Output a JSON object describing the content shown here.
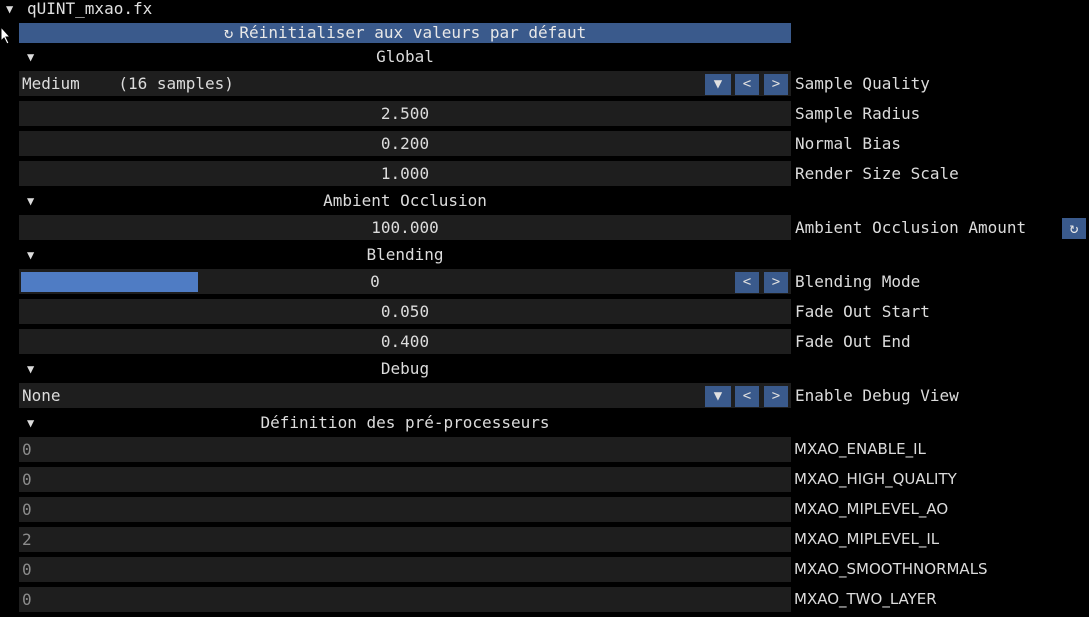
{
  "header": {
    "title": "qUINT_mxao.fx",
    "expand_glyph": "▼",
    "reset_label": "Réinitialiser aux valeurs par défaut",
    "reset_icon": "↻"
  },
  "sections": {
    "global": "Global",
    "ambient": "Ambient Occlusion",
    "blending": "Blending",
    "debug": "Debug",
    "preprocessors": "Définition des pré-processeurs"
  },
  "controls": {
    "sample_quality": {
      "value": "Medium    (16 samples)",
      "label": "Sample Quality"
    },
    "sample_radius": {
      "value": "2.500",
      "label": "Sample Radius"
    },
    "normal_bias": {
      "value": "0.200",
      "label": "Normal Bias"
    },
    "render_size_scale": {
      "value": "1.000",
      "label": "Render Size Scale"
    },
    "ao_amount": {
      "value": "100.000",
      "label": "Ambient Occlusion Amount"
    },
    "blending_mode": {
      "value": "0",
      "label": "Blending Mode",
      "fill_fraction": 0.23
    },
    "fade_out_start": {
      "value": "0.050",
      "label": "Fade Out Start"
    },
    "fade_out_end": {
      "value": "0.400",
      "label": "Fade Out End"
    },
    "debug_view": {
      "value": "None",
      "label": "Enable Debug View"
    }
  },
  "buttons": {
    "dropdown": "▼",
    "prev": "<",
    "next": ">",
    "reset_small": "↻"
  },
  "preprocessors": [
    {
      "value": "0",
      "name": "MXAO_ENABLE_IL"
    },
    {
      "value": "0",
      "name": "MXAO_HIGH_QUALITY"
    },
    {
      "value": "0",
      "name": "MXAO_MIPLEVEL_AO"
    },
    {
      "value": "2",
      "name": "MXAO_MIPLEVEL_IL"
    },
    {
      "value": "0",
      "name": "MXAO_SMOOTHNORMALS"
    },
    {
      "value": "0",
      "name": "MXAO_TWO_LAYER"
    }
  ],
  "colors": {
    "background": "#000000",
    "field": "#1e1e1e",
    "accent": "#3a5a8c",
    "slider": "#4f7cc4"
  }
}
